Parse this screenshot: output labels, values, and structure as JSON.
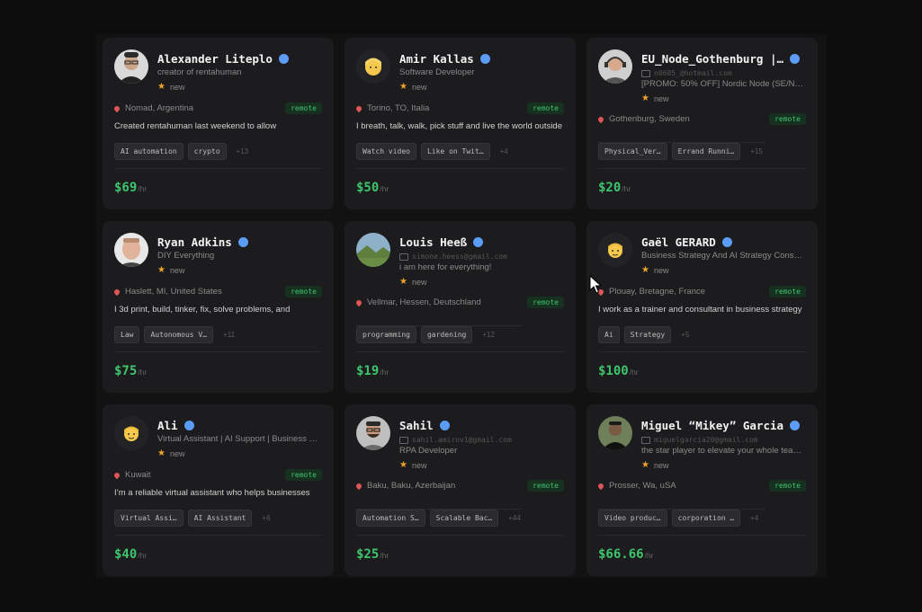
{
  "colors": {
    "accent_green": "#3ec46d",
    "verified_blue": "#5b9cf5",
    "star": "#f0a32a"
  },
  "cards": [
    {
      "name": "Alexander Liteplo",
      "subtitle": "creator of rentahuman",
      "email": "",
      "status": "new",
      "location": "Nomad, Argentina",
      "remote": "remote",
      "bio": "Created rentahuman last weekend to allow",
      "tags": [
        "AI automation",
        "crypto"
      ],
      "more": "+13",
      "price": "$69",
      "per": "/hr",
      "avatar": "photo-man-glasses"
    },
    {
      "name": "Amir Kallas",
      "subtitle": "Software Developer",
      "email": "",
      "status": "new",
      "location": "Torino, TO, Italia",
      "remote": "remote",
      "bio": "I breath, talk, walk, pick stuff and live the world outside",
      "tags": [
        "Watch video",
        "Like on Twit…"
      ],
      "more": "+4",
      "price": "$50",
      "per": "/hr",
      "avatar": "emoji-blonde-person"
    },
    {
      "name": "EU_Node_Gothenburg |…",
      "subtitle": "[PROMO: 50% OFF] Nordic Node (SE/N…",
      "email": "n0605_@hotmail.com",
      "status": "new",
      "location": "Gothenburg, Sweden",
      "remote": "remote",
      "bio": "",
      "tags": [
        "Physical_Ver…",
        "Errand Runni…"
      ],
      "more": "+15",
      "price": "$20",
      "per": "/hr",
      "avatar": "photo-man-headset"
    },
    {
      "name": "Ryan Adkins",
      "subtitle": "DIY Everything",
      "email": "",
      "status": "new",
      "location": "Haslett, MI, United States",
      "remote": "remote",
      "bio": "I 3d print, build, tinker, fix, solve problems, and",
      "tags": [
        "Law",
        "Autonomous V…"
      ],
      "more": "+11",
      "price": "$75",
      "per": "/hr",
      "avatar": "photo-man-face"
    },
    {
      "name": "Louis Heeß",
      "subtitle": "i am here for everything!",
      "email": "simone.heess@gmail.com",
      "status": "new",
      "location": "Vellmar, Hessen, Deutschland",
      "remote": "remote",
      "bio": "",
      "tags": [
        "programming",
        "gardening"
      ],
      "more": "+12",
      "price": "$19",
      "per": "/hr",
      "avatar": "photo-landscape"
    },
    {
      "name": "Gaël GERARD",
      "subtitle": "Business Strategy And AI Strategy Cons…",
      "email": "",
      "status": "new",
      "location": "Plouay, Bretagne, France",
      "remote": "remote",
      "bio": "I work as a trainer and consultant in business strategy",
      "tags": [
        "Ai",
        "Strategy"
      ],
      "more": "+5",
      "price": "$100",
      "per": "/hr",
      "avatar": "emoji-person"
    },
    {
      "name": "Ali",
      "subtitle": "Virtual Assistant | AI Support | Business …",
      "email": "",
      "status": "new",
      "location": "Kuwait",
      "remote": "remote",
      "bio": "I’m a reliable virtual assistant who helps businesses",
      "tags": [
        "Virtual Assi…",
        "AI Assistant"
      ],
      "more": "+6",
      "price": "$40",
      "per": "/hr",
      "avatar": "emoji-person"
    },
    {
      "name": "Sahil",
      "subtitle": "RPA Developer",
      "email": "sahil.amirov1@gmail.com",
      "status": "new",
      "location": "Baku, Baku, Azerbaijan",
      "remote": "remote",
      "bio": "",
      "tags": [
        "Automation S…",
        "Scalable Bac…"
      ],
      "more": "+44",
      "price": "$25",
      "per": "/hr",
      "avatar": "photo-man-glasses-beard"
    },
    {
      "name": "Miguel “Mikey” Garcia",
      "subtitle": "the star player to elevate your whole tea…",
      "email": "miguelgarcia20@gmail.com",
      "status": "new",
      "location": "Prosser, Wa, uSA",
      "remote": "remote",
      "bio": "",
      "tags": [
        "Video produc…",
        "corporation …"
      ],
      "more": "+4",
      "price": "$66.66",
      "per": "/hr",
      "avatar": "photo-man-dark"
    }
  ]
}
